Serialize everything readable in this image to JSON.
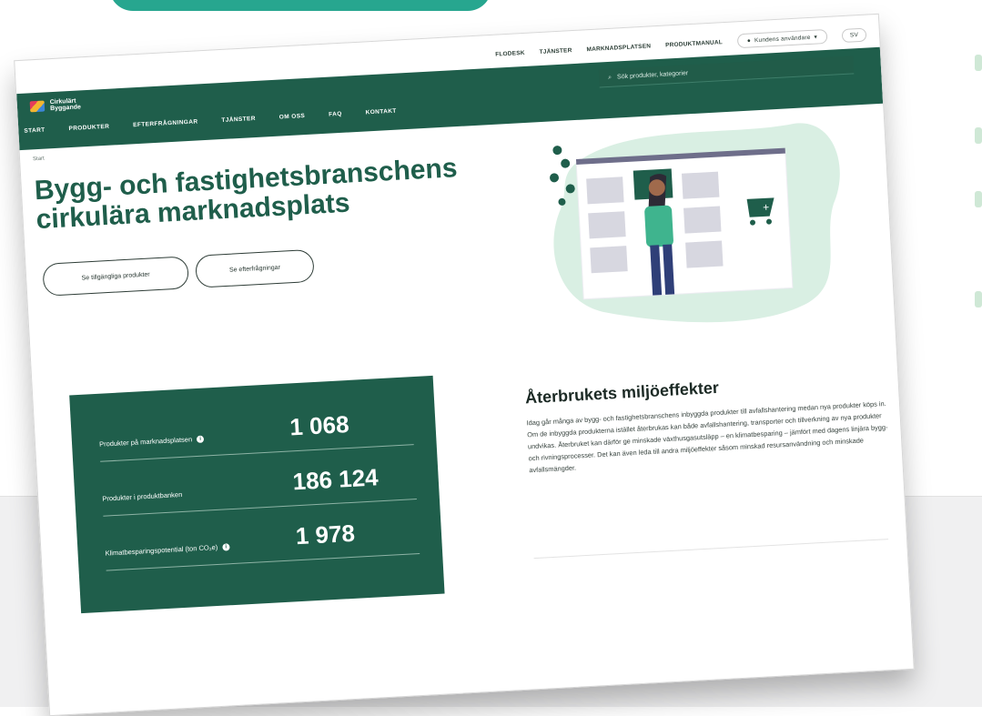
{
  "header": {
    "links": [
      "Flodesk",
      "Tjänster",
      "Marknadsplatsen",
      "Produktmanual"
    ],
    "account_label": "Kundens användare",
    "language": "SV"
  },
  "brand": {
    "name": "Cirkulärt Byggande",
    "colors": {
      "primary": "#1f5e4b",
      "banner": "#27a68f",
      "accent": "#3fb48e"
    }
  },
  "search": {
    "placeholder": "Sök produkter, kategorier",
    "icon": "search-icon"
  },
  "nav": {
    "items": [
      "Start",
      "Produkter",
      "Efterfrågningar",
      "Tjänster",
      "Om oss",
      "FAQ",
      "Kontakt"
    ]
  },
  "breadcrumb": "Start",
  "hero": {
    "title": "Bygg- och fastighetsbranschens cirkulära marknadsplats",
    "buttons": {
      "products": "Se tillgängliga produkter",
      "requests": "Se efterfrågningar"
    }
  },
  "stats": [
    {
      "label": "Produkter på marknadsplatsen",
      "value": "1 068",
      "info": true
    },
    {
      "label": "Produkter i produktbanken",
      "value": "186 124",
      "info": false
    },
    {
      "label": "Klimatbesparingspotential (ton CO₂e)",
      "value": "1 978",
      "info": true
    }
  ],
  "effects": {
    "title": "Återbrukets miljöeffekter",
    "text": "Idag går många av bygg- och fastighetsbranschens inbyggda produkter till avfallshantering medan nya produkter köps in. Om de inbyggda produkterna istället återbrukas kan både avfallshantering, transporter och tillverkning av nya produkter undvikas. Återbruket kan därför ge minskade växthusgasutsläpp – en klimatbesparing – jämfört med dagens linjära bygg- och rivningsprocesser. Det kan även leda till andra miljöeffekter såsom minskad resursanvändning och minskade avfallsmängder."
  }
}
